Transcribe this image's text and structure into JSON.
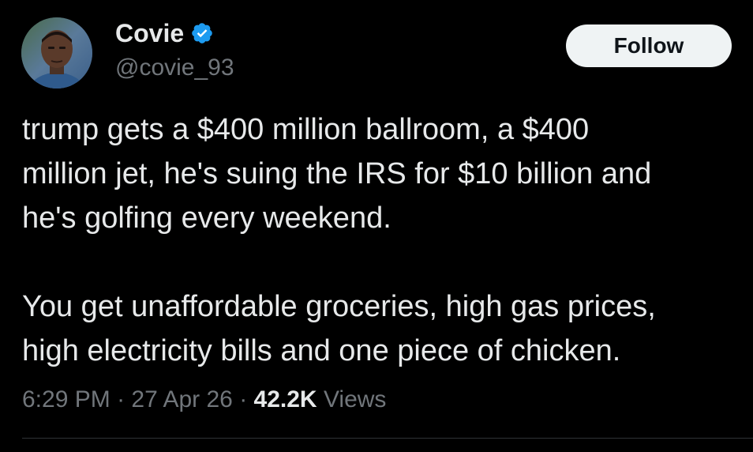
{
  "author": {
    "display_name": "Covie",
    "handle": "@covie_93",
    "verified": true,
    "avatar_icon": "profile-photo",
    "verified_icon": "verified-badge-icon"
  },
  "follow_button": {
    "label": "Follow"
  },
  "tweet": {
    "lines": [
      "trump gets a $400 million ballroom, a $400",
      "million jet, he's suing the IRS for $10 billion and",
      "he's golfing every weekend.",
      "You get unaffordable groceries, high gas prices,",
      "high electricity bills and one piece of chicken."
    ]
  },
  "meta": {
    "time": "6:29 PM",
    "separator": "·",
    "date": "27 Apr 26",
    "views_count": "42.2K",
    "views_label": "Views"
  },
  "colors": {
    "background": "#000000",
    "text_primary": "#e7e9ea",
    "text_secondary": "#71767b",
    "verified_blue": "#1d9bf0",
    "follow_bg": "#eff3f4",
    "divider": "#2f3336"
  }
}
